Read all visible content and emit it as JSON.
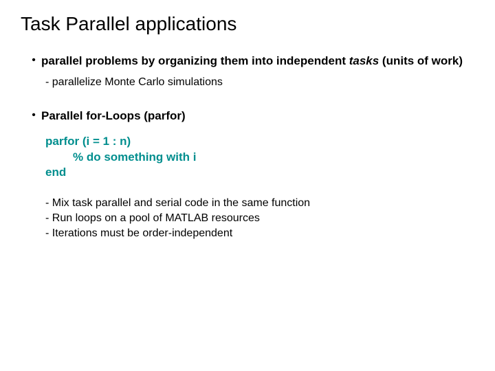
{
  "title": "Task Parallel applications",
  "bullets": [
    {
      "pre": "parallel problems by organizing them into independent ",
      "em": "tasks",
      "post": " (units of work)",
      "sub": "- parallelize Monte Carlo simulations"
    },
    {
      "text": "Parallel for-Loops (parfor)"
    }
  ],
  "code": {
    "line1": "parfor (i = 1 : n)",
    "line2": "% do something with i",
    "line3": "end"
  },
  "notes": {
    "n1": "- Mix task parallel and serial code in the same function",
    "n2": "- Run loops on a pool of MATLAB resources",
    "n3": "-  Iterations must be order-independent"
  },
  "glyphs": {
    "bullet": "•"
  }
}
